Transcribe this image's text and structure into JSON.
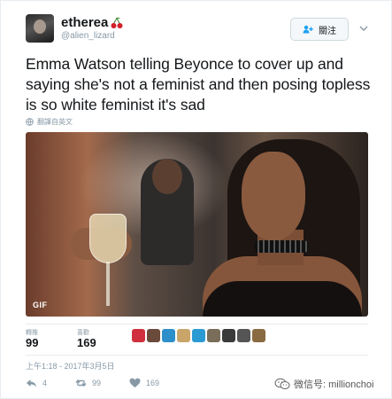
{
  "header": {
    "display_name": "etherea",
    "name_emoji": "cherry-emoji",
    "handle": "@alien_lizard",
    "follow_label": "關注"
  },
  "tweet": {
    "text": "Emma Watson telling Beyonce to cover up and saying she's not a feminist and then posing topless is so white feminist it's sad",
    "translate_label": "翻譯自英文"
  },
  "media": {
    "badge": "GIF"
  },
  "stats": {
    "retweets_label": "轉推",
    "retweets": "99",
    "likes_label": "喜歡",
    "likes": "169"
  },
  "timestamp": "上午1:18 - 2017年3月5日",
  "actions": {
    "reply_count": "4",
    "retweet_count": "99",
    "like_count": "169"
  },
  "watermark": {
    "text": "微信号: millionchoi"
  },
  "colors": {
    "text": "#14171a",
    "muted": "#8899a6",
    "border": "#e6ecf0",
    "brand_red": "#d4202a"
  }
}
